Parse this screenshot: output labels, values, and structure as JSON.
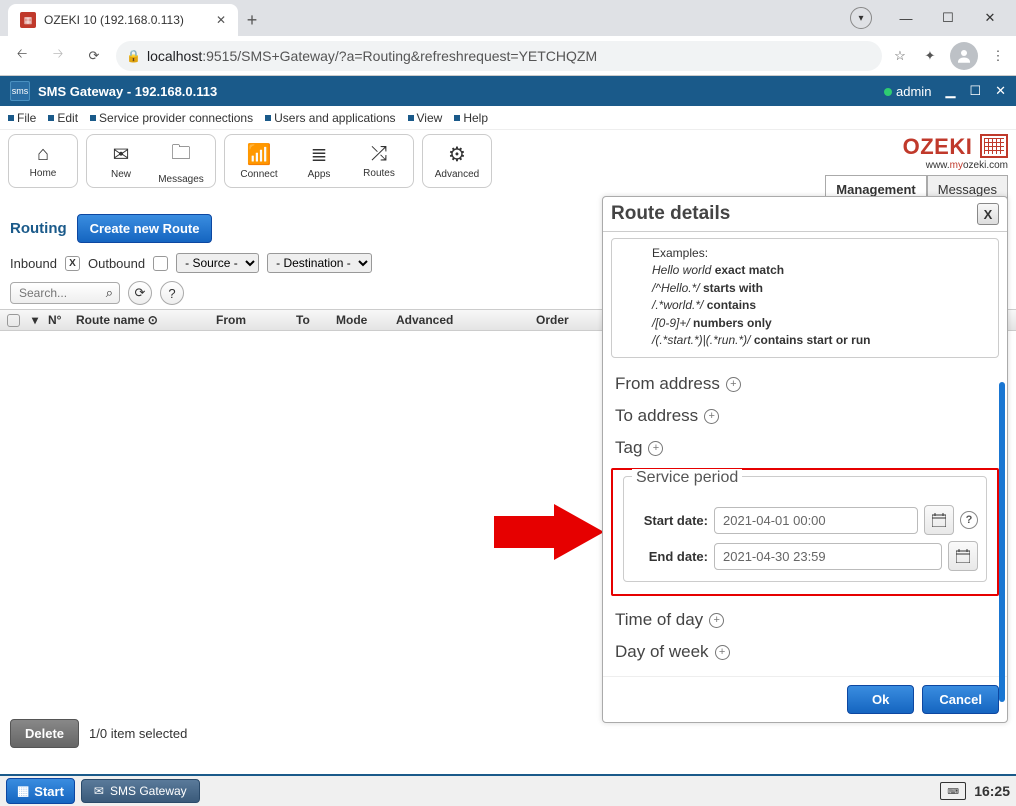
{
  "browser": {
    "tab_title": "OZEKI 10 (192.168.0.113)",
    "url_host": "localhost",
    "url_rest": ":9515/SMS+Gateway/?a=Routing&refreshrequest=YETCHQZM"
  },
  "app_bar": {
    "title": "SMS Gateway - 192.168.0.113",
    "user": "admin"
  },
  "menu": {
    "file": "File",
    "edit": "Edit",
    "svc": "Service provider connections",
    "users": "Users and applications",
    "view": "View",
    "help": "Help"
  },
  "toolbar": {
    "home": "Home",
    "new": "New",
    "messages": "Messages",
    "connect": "Connect",
    "apps": "Apps",
    "routes": "Routes",
    "advanced": "Advanced"
  },
  "logo": {
    "text1": "OZEK",
    "text2": "I",
    "sub1": "www.",
    "sub2": "my",
    "sub3": "ozeki.com"
  },
  "right_tabs": {
    "management": "Management",
    "messages": "Messages"
  },
  "sub": {
    "routing": "Routing",
    "create": "Create new Route"
  },
  "filter": {
    "inbound": "Inbound",
    "outbound": "Outbound",
    "source_ph": "- Source -",
    "dest_ph": "- Destination -"
  },
  "search": {
    "placeholder": "Search..."
  },
  "table": {
    "no": "N°",
    "name": "Route name",
    "from": "From",
    "to": "To",
    "mode": "Mode",
    "advanced": "Advanced",
    "order": "Order"
  },
  "bottom": {
    "delete": "Delete",
    "status": "1/0 item selected"
  },
  "panel": {
    "title": "Route details",
    "examples_label": "Examples:",
    "ex1a": "Hello world",
    "ex1b": "exact match",
    "ex2a": "/^Hello.*/",
    "ex2b": "starts with",
    "ex3a": "/.*world.*/",
    "ex3b": "contains",
    "ex4a": "/[0-9]+/",
    "ex4b": "numbers only",
    "ex5a": "/(.*start.*)|(.*run.*)/",
    "ex5b": "contains start or run",
    "from_addr": "From address",
    "to_addr": "To address",
    "tag": "Tag",
    "service_period": "Service period",
    "start_label": "Start date:",
    "start_val": "2021-04-01 00:00",
    "end_label": "End date:",
    "end_val": "2021-04-30 23:59",
    "time_of_day": "Time of day",
    "day_of_week": "Day of week",
    "ok": "Ok",
    "cancel": "Cancel"
  },
  "taskbar": {
    "start": "Start",
    "app": "SMS Gateway",
    "time": "16:25"
  }
}
